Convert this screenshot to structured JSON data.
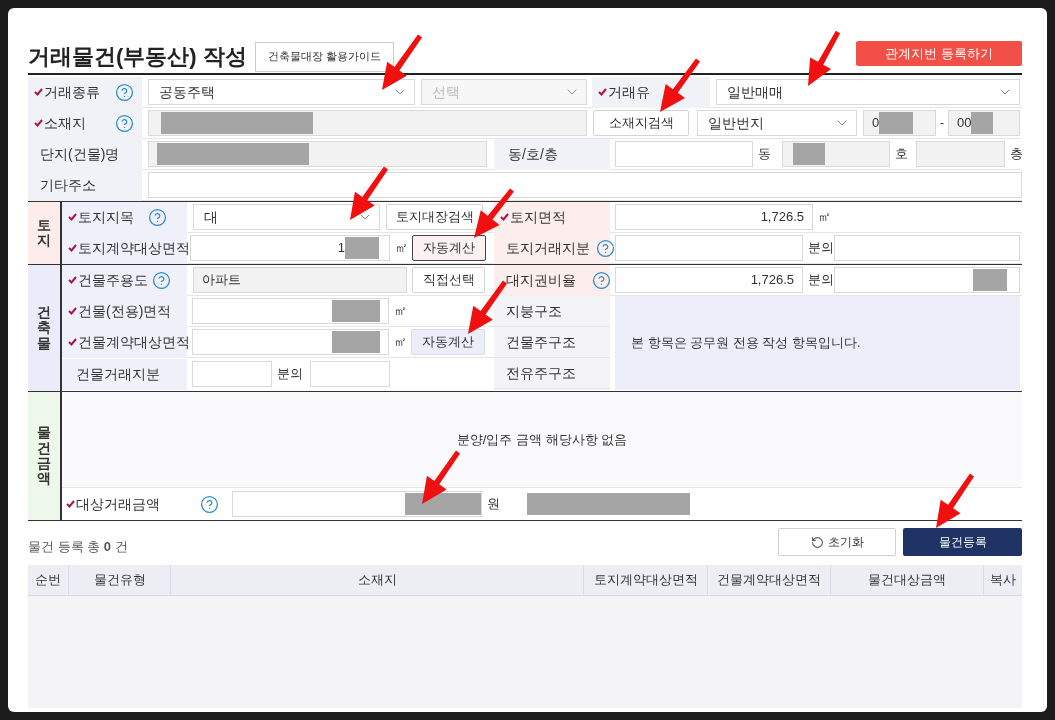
{
  "title": "거래물건(부동산) 작성",
  "guide_button": "건축물대장 활용가이드",
  "related_lot_button": "관계지번 등록하기",
  "deal_type": {
    "label": {
      "text": "거래종류",
      "required": true,
      "help": true
    },
    "value": "공동주택",
    "sub_select": {
      "placeholder": "선택",
      "disabled": true
    }
  },
  "deal_method": {
    "label": {
      "text": "거래유",
      "required": true,
      "help": false
    },
    "value": "일반매매"
  },
  "location": {
    "label": {
      "text": "소재지",
      "required": true,
      "help": true
    },
    "search_button": "소재지검색",
    "lot_type": "일반번지",
    "main_no": "0",
    "separator": "-",
    "sub_no": "00"
  },
  "complex": {
    "label": {
      "text": "단지(건물)명",
      "required": false,
      "help": false
    },
    "unit_label": {
      "text": "동/호/층",
      "required": false,
      "help": false
    },
    "dong_unit": "동",
    "ho_unit": "호",
    "floor_unit": "층"
  },
  "other_address": {
    "label": {
      "text": "기타주소",
      "required": false,
      "help": false
    }
  },
  "land": {
    "section": "토지",
    "category": {
      "label": {
        "text": "토지지목",
        "required": true,
        "help": true
      },
      "value": "대",
      "search_button": "토지대장검색"
    },
    "area": {
      "label": {
        "text": "토지면적",
        "required": true,
        "help": false
      },
      "value": "1,726.5",
      "unit": "㎡"
    },
    "contract_area": {
      "label": {
        "text": "토지계약대상면적",
        "required": true,
        "help": false
      },
      "value": "1",
      "unit": "㎡",
      "calc_button": "자동계산"
    },
    "share": {
      "label": {
        "text": "토지거래지분",
        "required": false,
        "help": true
      },
      "of": "분의"
    }
  },
  "building": {
    "section": "건축물",
    "use": {
      "label": {
        "text": "건물주용도",
        "required": true,
        "help": true
      },
      "value": "아파트",
      "select_button": "직접선택"
    },
    "land_ratio": {
      "label": {
        "text": "대지권비율",
        "required": false,
        "help": true
      },
      "value": "1,726.5",
      "of": "분의"
    },
    "exclusive_area": {
      "label": {
        "text": "건물(전용)면적",
        "required": true,
        "help": false
      },
      "unit": "㎡"
    },
    "contract_area": {
      "label": {
        "text": "건물계약대상면적",
        "required": true,
        "help": false
      },
      "unit": "㎡",
      "calc_button": "자동계산"
    },
    "share": {
      "label": {
        "text": "건물거래지분",
        "required": false,
        "help": false
      },
      "of": "분의"
    },
    "structure_labels": [
      "지붕구조",
      "건물주구조",
      "전유주구조"
    ],
    "structure_note": "본 항목은 공무원 전용 작성 항목입니다."
  },
  "amount": {
    "section": "물건금액",
    "note": "분양/입주 금액 해당사항 없음",
    "deal_amount": {
      "label": {
        "text": "대상거래금액",
        "required": true,
        "help": true
      },
      "unit": "원"
    }
  },
  "count_text": "물건 등록 총 **0** 건",
  "reset_button": "초기화",
  "register_button": "물건등록",
  "table": {
    "columns": [
      "순번",
      "물건유형",
      "소재지",
      "토지계약대상면적",
      "건물계약대상면적",
      "물건대상금액",
      "복사"
    ]
  }
}
